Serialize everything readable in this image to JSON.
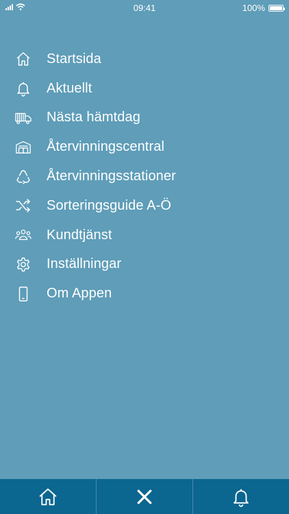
{
  "status_bar": {
    "time": "09:41",
    "battery": "100%",
    "battery_level": 1.0
  },
  "menu": {
    "items": [
      {
        "label": "Startsida",
        "icon": "home-icon"
      },
      {
        "label": "Aktuellt",
        "icon": "bell-icon"
      },
      {
        "label": "Nästa hämtdag",
        "icon": "truck-icon"
      },
      {
        "label": "Återvinningscentral",
        "icon": "warehouse-icon"
      },
      {
        "label": "Återvinningsstationer",
        "icon": "recycle-icon"
      },
      {
        "label": "Sorteringsguide A-Ö",
        "icon": "shuffle-icon"
      },
      {
        "label": "Kundtjänst",
        "icon": "people-icon"
      },
      {
        "label": "Inställningar",
        "icon": "gear-icon"
      },
      {
        "label": "Om Appen",
        "icon": "phone-icon"
      }
    ]
  },
  "tab_bar": {
    "tabs": [
      {
        "icon": "home-icon"
      },
      {
        "icon": "close-icon"
      },
      {
        "icon": "bell-icon"
      }
    ]
  },
  "colors": {
    "background": "#5f9db8",
    "tab_bar": "#0b6690",
    "text": "#ffffff"
  }
}
